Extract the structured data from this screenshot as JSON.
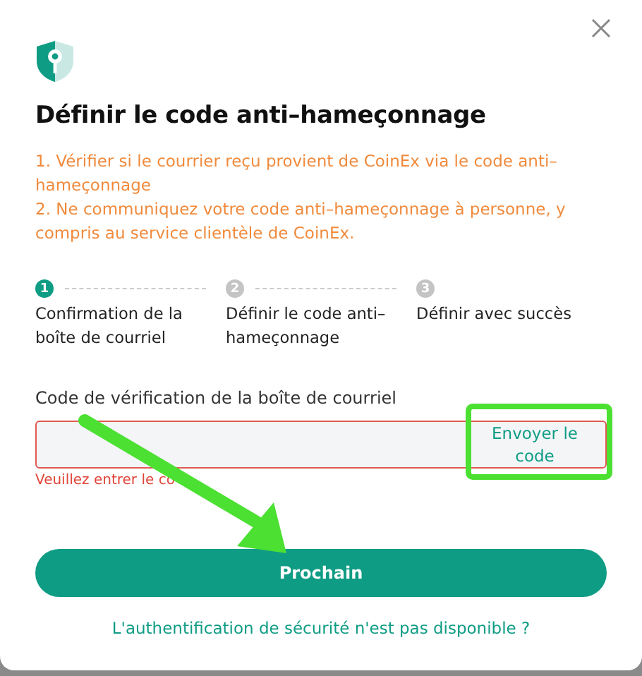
{
  "dialog": {
    "title": "Définir le code anti–hameçonnage",
    "notes": [
      "1. Vérifier si le courrier reçu provient de CoinEx via le code anti–hameçonnage",
      "2. Ne communiquez votre code anti–hameçonnage à personne, y compris au service clientèle de CoinEx."
    ]
  },
  "steps": [
    {
      "number": "1",
      "label": "Confirmation de la boîte de courriel",
      "selected": true
    },
    {
      "number": "2",
      "label": "Définir le code anti–hameçonnage",
      "selected": false
    },
    {
      "number": "3",
      "label": "Définir avec succès",
      "selected": false
    }
  ],
  "field": {
    "label": "Code de vérification de la boîte de courriel",
    "action": "Envoyer le code",
    "error": "Veuillez entrer le co",
    "invalid": true
  },
  "primary_button": "Prochain",
  "help_link": "L'authentification de sécurité n'est pas disponible ?",
  "annotations": {
    "highlight_box": true,
    "arrow": true
  }
}
